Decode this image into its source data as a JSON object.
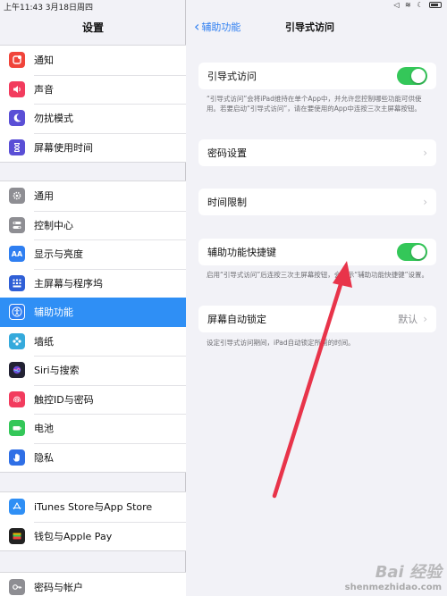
{
  "status_bar": {
    "time": "上午11:43  3月18日周四"
  },
  "sidebar": {
    "title": "设置",
    "group1": [
      {
        "label": "通知",
        "icon": "bell-icon",
        "color": "#f0443a"
      },
      {
        "label": "声音",
        "icon": "speaker-icon",
        "color": "#f23c5e"
      },
      {
        "label": "勿扰模式",
        "icon": "moon-icon",
        "color": "#5a4fd6"
      },
      {
        "label": "屏幕使用时间",
        "icon": "hourglass-icon",
        "color": "#5a4fd6"
      }
    ],
    "group2": [
      {
        "label": "通用",
        "icon": "gear-icon",
        "color": "#8e8e93"
      },
      {
        "label": "控制中心",
        "icon": "switches-icon",
        "color": "#8e8e93"
      },
      {
        "label": "显示与亮度",
        "icon": "aa-icon",
        "color": "#2f7ff1"
      },
      {
        "label": "主屏幕与程序坞",
        "icon": "grid-icon",
        "color": "#2f5fd6"
      },
      {
        "label": "辅助功能",
        "icon": "accessibility-icon",
        "color": "#2f7ff1"
      },
      {
        "label": "墙纸",
        "icon": "flower-icon",
        "color": "#35aadc"
      },
      {
        "label": "Siri与搜索",
        "icon": "siri-icon",
        "color": "#222233"
      },
      {
        "label": "触控ID与密码",
        "icon": "fingerprint-icon",
        "color": "#f23c5e"
      },
      {
        "label": "电池",
        "icon": "battery-icon",
        "color": "#34c759"
      },
      {
        "label": "隐私",
        "icon": "hand-icon",
        "color": "#2f6fe6"
      }
    ],
    "group3": [
      {
        "label": "iTunes Store与App Store",
        "icon": "appstore-icon",
        "color": "#2f8ff5"
      },
      {
        "label": "钱包与Apple Pay",
        "icon": "wallet-icon",
        "color": "#222222"
      }
    ],
    "group4": [
      {
        "label": "密码与帐户",
        "icon": "key-icon",
        "color": "#8e8e93"
      }
    ]
  },
  "detail": {
    "back_label": "辅助功能",
    "title": "引导式访问",
    "guided_access_label": "引导式访问",
    "guided_access_note": "“引导式访问”会将iPad维持在单个App中，并允许您控制哪些功能可供使用。若要启动“引导式访问”，请在要使用的App中连按三次主屏幕按钮。",
    "passcode_label": "密码设置",
    "time_limits_label": "时间限制",
    "shortcut_label": "辅助功能快捷键",
    "shortcut_note": "启用“引导式访问”后连按三次主屏幕按钮，会显示“辅助功能快捷键”设置。",
    "autolock_label": "屏幕自动锁定",
    "autolock_value": "默认",
    "autolock_note": "设定引导式访问期间，iPad自动锁定所需的时间。"
  },
  "watermark": {
    "logo": "Bai 经验",
    "url": "shenmezhidao.com"
  }
}
